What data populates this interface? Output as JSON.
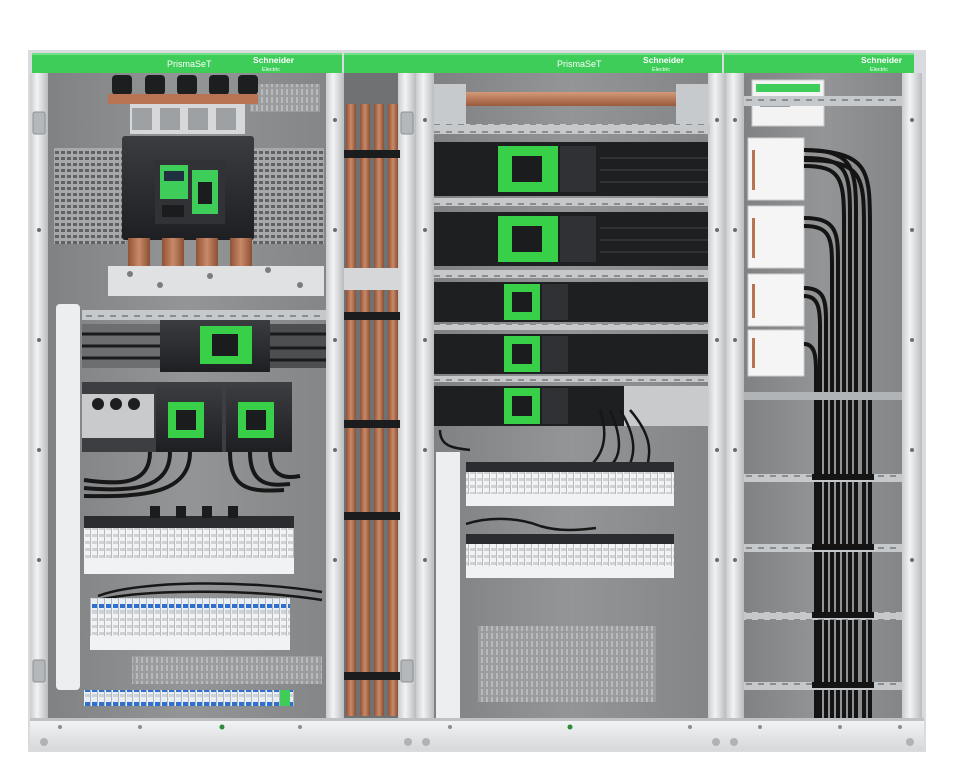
{
  "product_label": "PrismaSeT",
  "brand": {
    "line1": "Schneider",
    "line2": "Electric"
  },
  "colors": {
    "brand_green": "#3dcd58",
    "brand_green_dark": "#149a38",
    "cabinet_grey": "#8d8f91",
    "frame_silver": "#e6e8ea",
    "copper": "#b87352",
    "cable": "#1a1a1a",
    "breaker_body": "#2b2d30",
    "breaker_face": "#39d049",
    "terminal_white": "#f4f4f4"
  },
  "sections": [
    {
      "name": "incomer-section",
      "has_product_label": true
    },
    {
      "name": "feeder-section",
      "has_product_label": true
    },
    {
      "name": "cabling-section",
      "has_product_label": false
    }
  ]
}
